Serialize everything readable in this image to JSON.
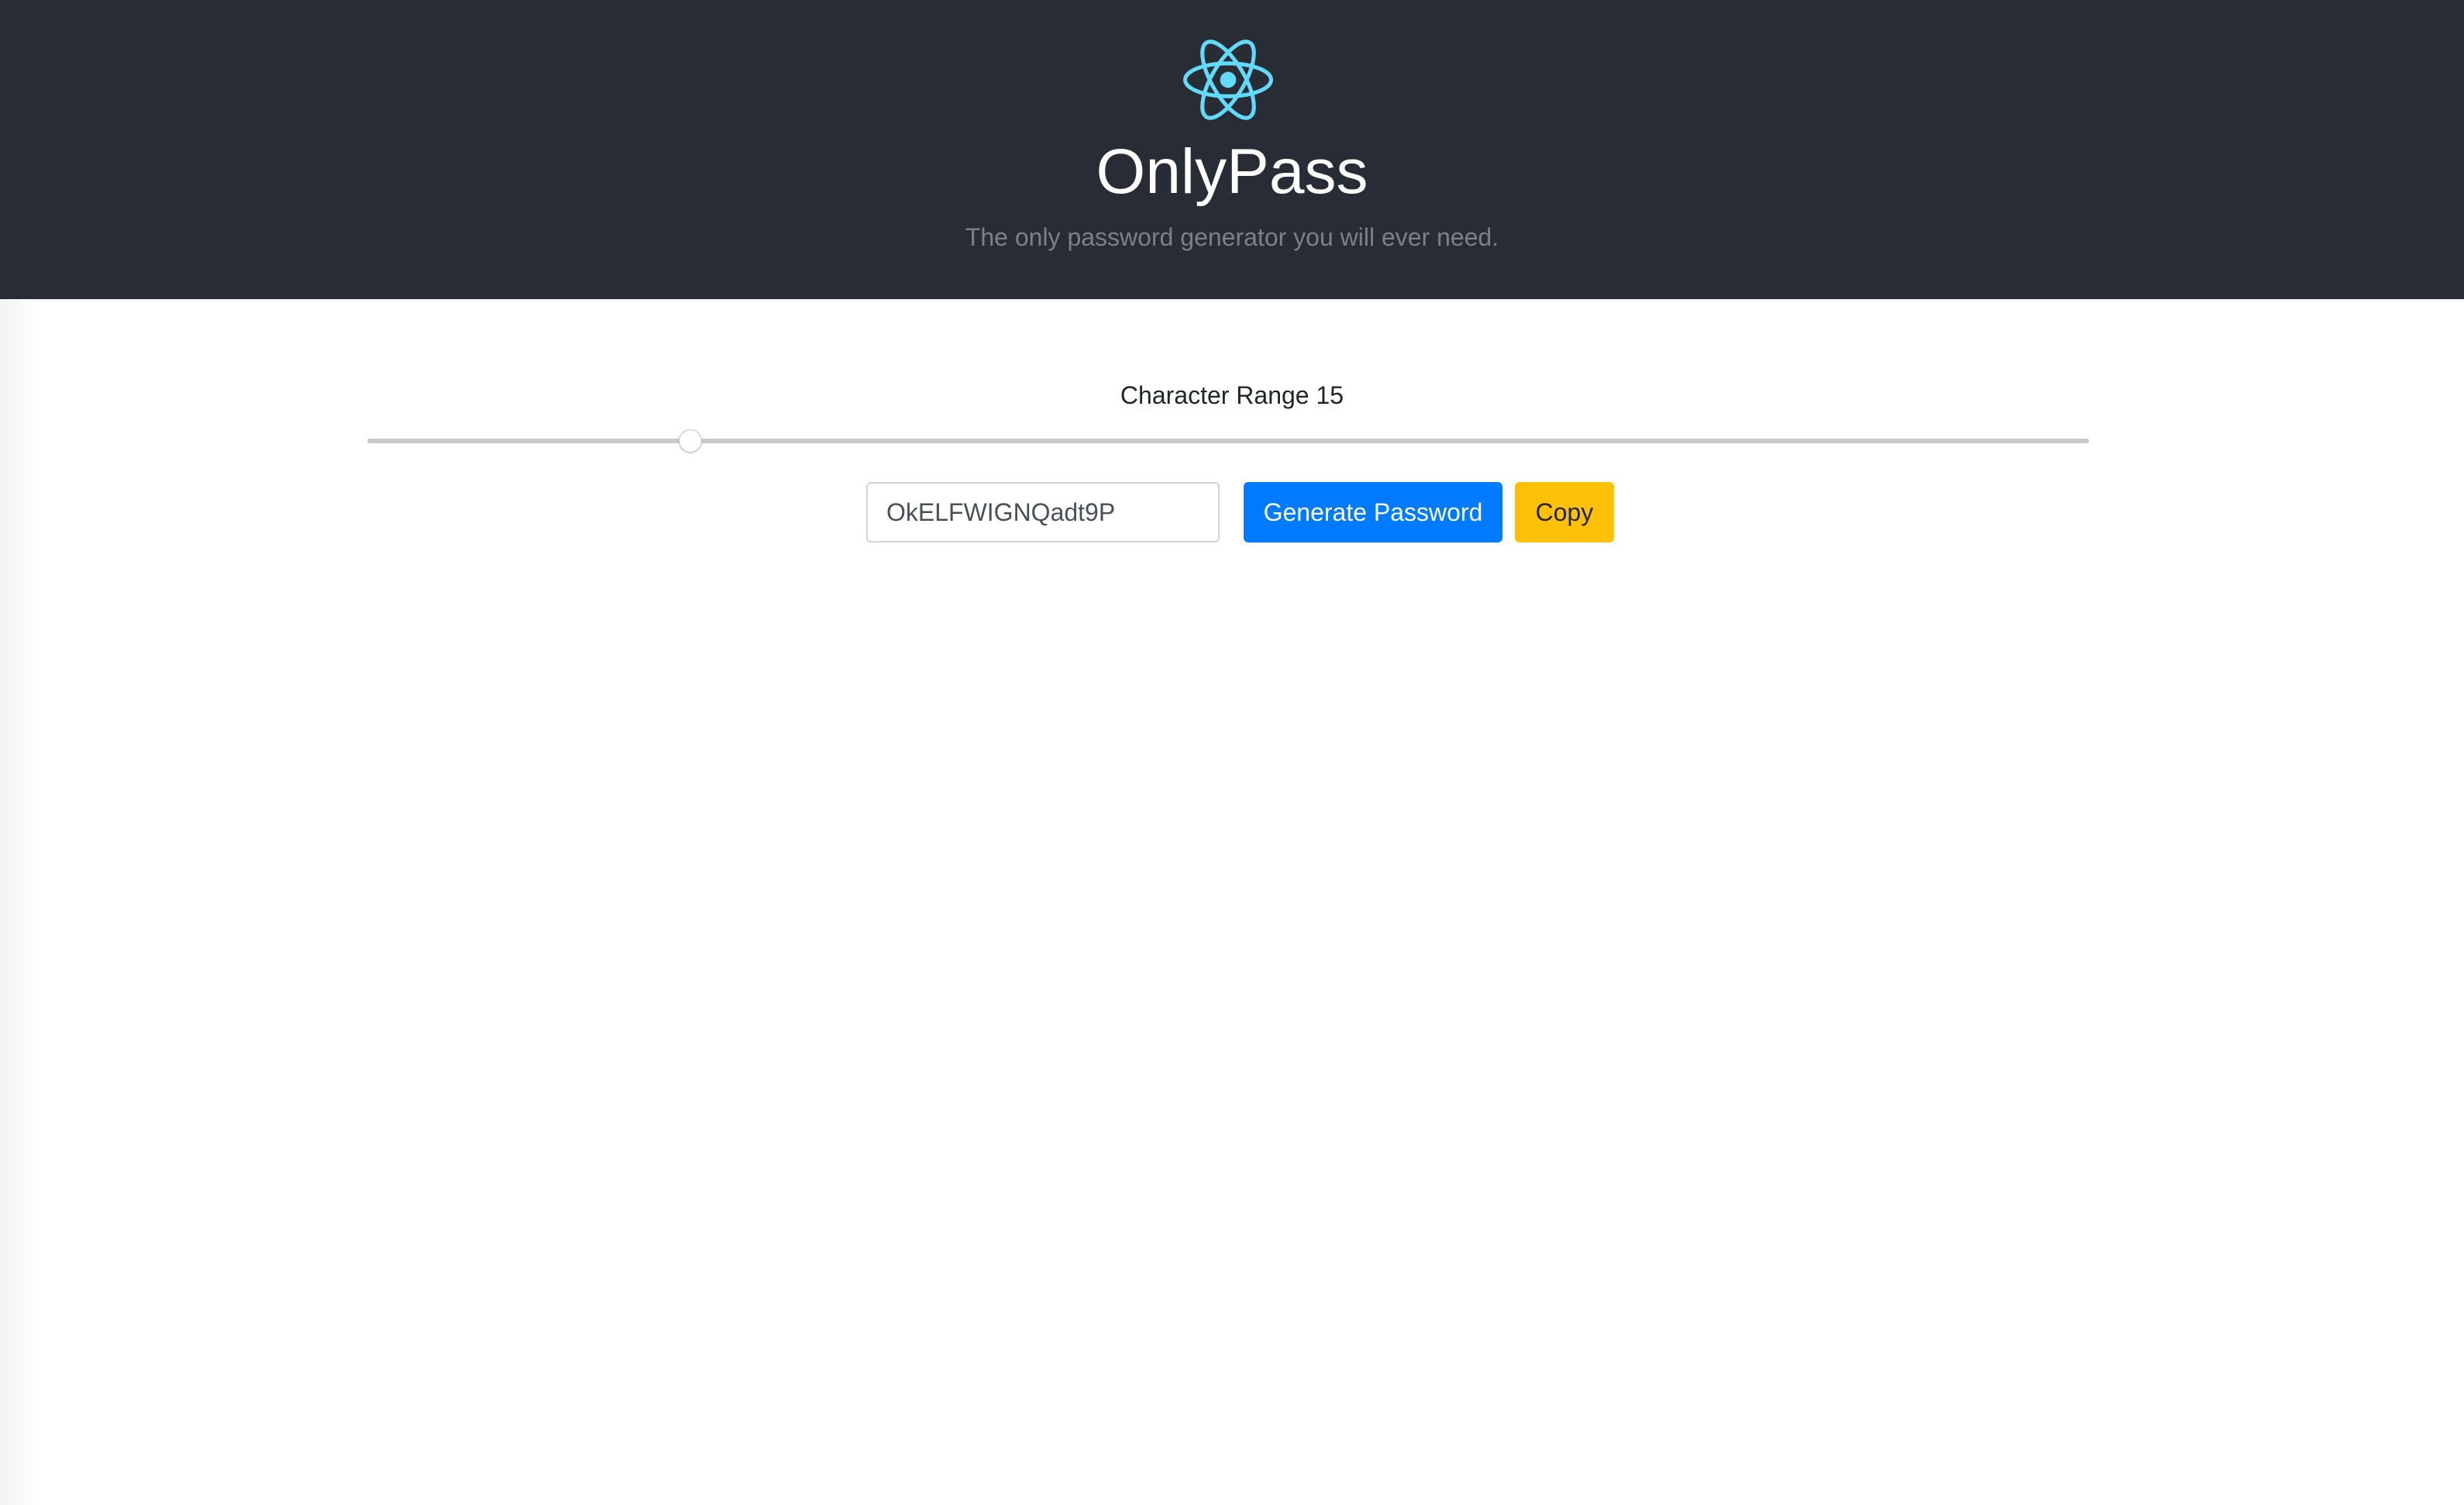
{
  "header": {
    "logo_icon": "react-atom-icon",
    "logo_color": "#61dafb",
    "background": "#282c34",
    "title": "OnlyPass",
    "subtitle": "The only password generator you will ever need."
  },
  "main": {
    "range_label": "Character Range",
    "range_value": "15",
    "slider": {
      "min": 0,
      "max": 80,
      "value": 15
    },
    "password_value": "OkELFWIGNQadt9P",
    "generate_label": "Generate Password",
    "copy_label": "Copy",
    "colors": {
      "generate_button": "#007bff",
      "copy_button": "#ffc107"
    }
  }
}
